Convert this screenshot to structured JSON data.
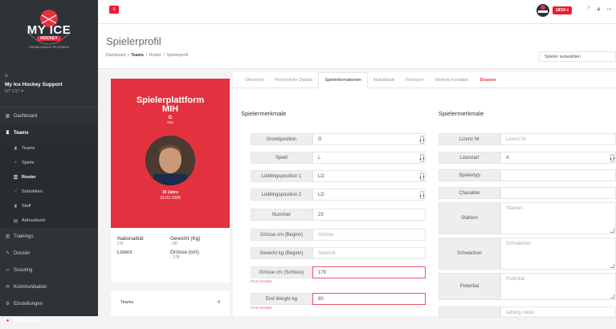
{
  "sidebar": {
    "logo_text": "MY ICE",
    "logo_sub": "HOCKEY",
    "logo_arc": "FROM COACH TO COACH",
    "user_initial": "A",
    "user_name": "My Ice Hockey Support",
    "user_role": "NT U17 ▾",
    "nav": {
      "dashboard": "Dashboard",
      "teams": "Teams",
      "sub_teams": "Teams",
      "sub_spiele": "Spiele",
      "sub_roster": "Roster",
      "sub_statistiken": "Statistiken",
      "sub_staff": "Staff",
      "sub_adressbuch": "Adressbuch",
      "trainings": "Trainings",
      "dossier": "Dossier",
      "scouting": "Scouting",
      "kommunikation": "Kommunikation",
      "einstellungen": "Einstellungen",
      "admin": "Admin Zone"
    }
  },
  "topbar": {
    "menu_icon": "≡",
    "season": "18/19 ▾",
    "help": "?",
    "user_icon": "♟",
    "logout_icon": "↦"
  },
  "header": {
    "title": "Spielerprofil",
    "crumb_dashboard": "Dashboard",
    "crumb_teams": "Teams",
    "crumb_roster": "Roster",
    "crumb_profile": "Spielerprofil",
    "sep": "/",
    "player_select": "Spieler auswählen"
  },
  "card": {
    "title_line1": "Spielerplattform",
    "title_line2": "MIH",
    "position": "G",
    "number": "#23",
    "age": "19 Jahre",
    "dob": "02.02.1999"
  },
  "info": {
    "nationality_label": "Nationalität",
    "nationality_value": "CH",
    "weight_label": "Gewicht (Kg)",
    "weight_value": "- 80",
    "license_label": "Lizenz",
    "height_label": "Grösse (cm)",
    "height_value": "- 178"
  },
  "teams_box": {
    "col_teams": "Teams",
    "col_num": "#"
  },
  "tabs": {
    "uebersicht": "Übersicht",
    "details": "Persönliche Details",
    "spielinfo": "Spielinformationen",
    "notfall": "Notfallblatt",
    "finanzen": "Finanzen",
    "kontakte": "Weitere Kontakte",
    "dossier": "Dossier"
  },
  "left_section": {
    "title": "Spielermerkmale",
    "grundposition_label": "Grundposition",
    "grundposition_value": "G",
    "spielt_label": "Spielt",
    "spielt_value": "L",
    "lp1_label": "Lieblingsposition 1",
    "lp1_value": "LD",
    "lp2_label": "Lieblingsposition 2",
    "lp2_value": "LD",
    "nummer_label": "Nummer",
    "nummer_value": "23",
    "gb_label": "Grösse cm (Beginn)",
    "gb_placeholder": "Grösse",
    "wb_label": "Gewicht kg (Beginn)",
    "wb_placeholder": "Gewicht",
    "gs_label": "Grösse cm (Schluss)",
    "gs_value": "178",
    "from_dossier": "From Dossier",
    "ew_label": "End Weight kg",
    "ew_value": "80",
    "caret": "▲▼"
  },
  "right_section": {
    "title": "Spielermerkmale",
    "lizenznr_label": "Lizenz Nr",
    "lizenznr_placeholder": "Lizenz Nr",
    "lizenzart_label": "Lizenzart",
    "lizenzart_value": "A",
    "spielertyp_label": "Spielertyp",
    "charakter_label": "Charakter",
    "staerken_label": "Stärken",
    "staerken_placeholder": "Stärken",
    "schwaechen_label": "Schwächen",
    "schwaechen_placeholder": "Schwächen",
    "potential_label": "Potential",
    "potential_placeholder": "Potential",
    "notes_placeholder": "Adding notes"
  },
  "colors": {
    "brand_red": "#e2323f",
    "sidebar_bg": "#2f3338"
  }
}
